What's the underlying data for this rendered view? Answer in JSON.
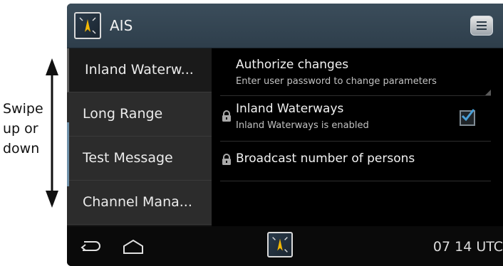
{
  "annotation": {
    "lines": [
      "Swipe",
      "up or",
      "down"
    ]
  },
  "actionbar": {
    "title": "AIS",
    "app_icon": "ais-compass-icon",
    "menu_icon": "menu-icon"
  },
  "left_list": {
    "items": [
      {
        "label": "Inland Waterw..."
      },
      {
        "label": "Long Range"
      },
      {
        "label": "Test Message"
      },
      {
        "label": "Channel Mana..."
      }
    ]
  },
  "settings": {
    "authorize": {
      "title": "Authorize changes",
      "subtitle": "Enter user password to change parameters"
    },
    "inland": {
      "title": "Inland Waterways",
      "subtitle": "Inland Waterways is enabled",
      "checked": true
    },
    "broadcast": {
      "title": "Broadcast number of persons"
    }
  },
  "navbar": {
    "time": "07 14 UTC",
    "back_icon": "back-icon",
    "home_icon": "home-icon"
  },
  "colors": {
    "actionbar": "#35475a",
    "check_accent": "#4aa0d8"
  }
}
